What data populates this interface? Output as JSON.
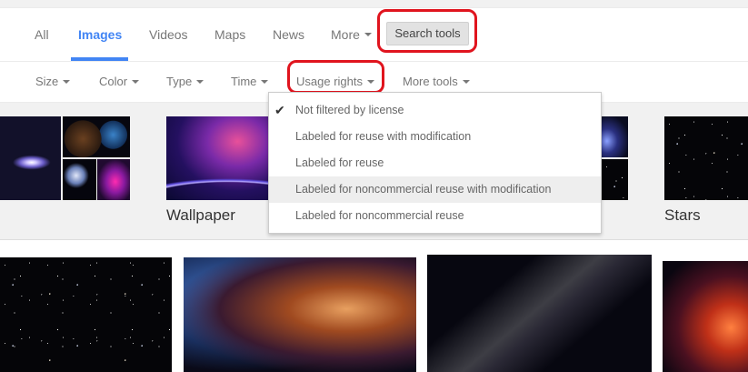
{
  "tabs": [
    {
      "label": "All"
    },
    {
      "label": "Images"
    },
    {
      "label": "Videos"
    },
    {
      "label": "Maps"
    },
    {
      "label": "News"
    },
    {
      "label": "More"
    }
  ],
  "search_tools_label": "Search tools",
  "tools": [
    {
      "label": "Size"
    },
    {
      "label": "Color"
    },
    {
      "label": "Type"
    },
    {
      "label": "Time"
    },
    {
      "label": "Usage rights"
    },
    {
      "label": "More tools"
    }
  ],
  "usage_menu": {
    "selected_mark": "✔",
    "items": [
      {
        "label": "Not filtered by license"
      },
      {
        "label": "Labeled for reuse with modification"
      },
      {
        "label": "Labeled for reuse"
      },
      {
        "label": "Labeled for noncommercial reuse with modification"
      },
      {
        "label": "Labeled for noncommercial reuse"
      }
    ]
  },
  "categories": [
    {
      "label": "Wallpaper"
    },
    {
      "label": "Stars"
    }
  ],
  "colors": {
    "accent": "#4285f4",
    "highlight": "#e0141e"
  }
}
